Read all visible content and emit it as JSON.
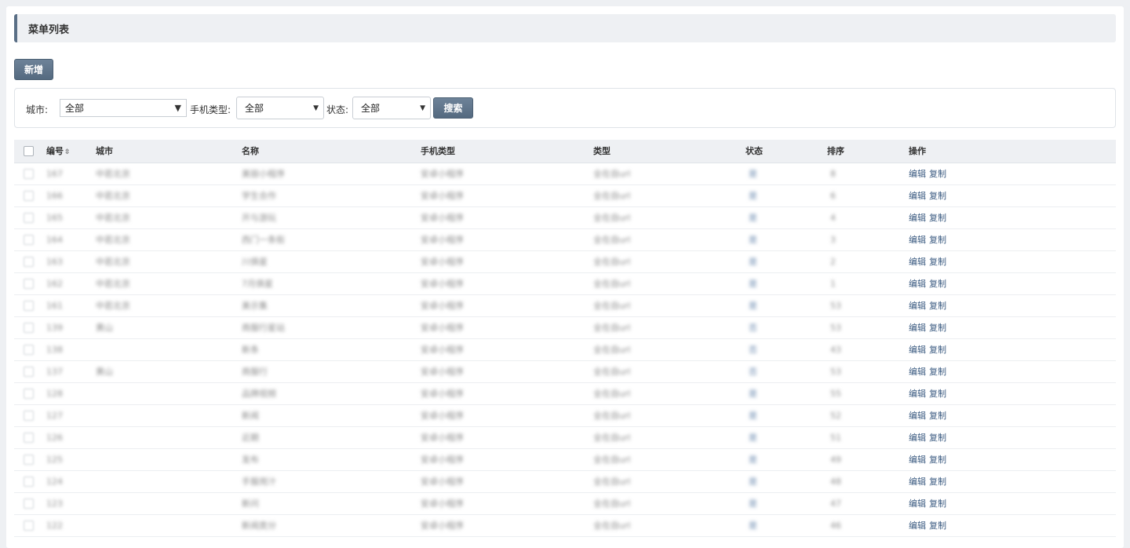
{
  "page": {
    "title": "菜单列表"
  },
  "toolbar": {
    "add_label": "新增"
  },
  "filters": {
    "city_label": "城市:",
    "city_value": "全部",
    "phone_type_label": "手机类型:",
    "phone_type_value": "全部",
    "status_label": "状态:",
    "status_value": "全部",
    "search_label": "搜索"
  },
  "table": {
    "headers": {
      "id": "编号",
      "city": "城市",
      "name": "名称",
      "phone_type": "手机类型",
      "type": "类型",
      "status": "状态",
      "sort": "排序",
      "ops": "操作"
    },
    "edit_label": "编辑",
    "copy_label": "复制",
    "rows": [
      {
        "id": "167",
        "city": "中若北京",
        "name": "美丽小程序",
        "phone_type": "安卓小程序",
        "type": "全在自url",
        "status": "是",
        "sort": "8"
      },
      {
        "id": "166",
        "city": "中若北京",
        "name": "学生合作",
        "phone_type": "安卓小程序",
        "type": "全在自url",
        "status": "是",
        "sort": "6"
      },
      {
        "id": "165",
        "city": "中若北京",
        "name": "开与游玩",
        "phone_type": "安卓小程序",
        "type": "全在自url",
        "status": "是",
        "sort": "4"
      },
      {
        "id": "164",
        "city": "中若北京",
        "name": "西门一条街",
        "phone_type": "安卓小程序",
        "type": "全在自url",
        "status": "是",
        "sort": "3"
      },
      {
        "id": "163",
        "city": "中若北京",
        "name": "川俱星",
        "phone_type": "安卓小程序",
        "type": "全在自url",
        "status": "是",
        "sort": "2"
      },
      {
        "id": "162",
        "city": "中若北京",
        "name": "7月俱星",
        "phone_type": "安卓小程序",
        "type": "全在自url",
        "status": "是",
        "sort": "1"
      },
      {
        "id": "161",
        "city": "中若北京",
        "name": "美示集",
        "phone_type": "安卓小程序",
        "type": "全在自url",
        "status": "是",
        "sort": "53"
      },
      {
        "id": "139",
        "city": "黄山",
        "name": "商服行星站",
        "phone_type": "安卓小程序",
        "type": "全在自url",
        "status": "否",
        "sort": "53"
      },
      {
        "id": "138",
        "city": "",
        "name": "新条",
        "phone_type": "安卓小程序",
        "type": "全在自url",
        "status": "否",
        "sort": "43"
      },
      {
        "id": "137",
        "city": "黄山",
        "name": "商服行",
        "phone_type": "安卓小程序",
        "type": "全在自url",
        "status": "否",
        "sort": "53"
      },
      {
        "id": "128",
        "city": "",
        "name": "品牌视频",
        "phone_type": "安卓小程序",
        "type": "全在自url",
        "status": "是",
        "sort": "55"
      },
      {
        "id": "127",
        "city": "",
        "name": "新闻",
        "phone_type": "安卓小程序",
        "type": "全在自url",
        "status": "是",
        "sort": "52"
      },
      {
        "id": "126",
        "city": "",
        "name": "近期",
        "phone_type": "安卓小程序",
        "type": "全在自url",
        "status": "是",
        "sort": "51"
      },
      {
        "id": "125",
        "city": "",
        "name": "发布",
        "phone_type": "安卓小程序",
        "type": "全在自url",
        "status": "是",
        "sort": "49"
      },
      {
        "id": "124",
        "city": "",
        "name": "手服用汁",
        "phone_type": "安卓小程序",
        "type": "全在自url",
        "status": "是",
        "sort": "48"
      },
      {
        "id": "123",
        "city": "",
        "name": "新问",
        "phone_type": "安卓小程序",
        "type": "全在自url",
        "status": "是",
        "sort": "47"
      },
      {
        "id": "122",
        "city": "",
        "name": "新闻类分",
        "phone_type": "安卓小程序",
        "type": "全在自url",
        "status": "是",
        "sort": "46"
      }
    ]
  }
}
